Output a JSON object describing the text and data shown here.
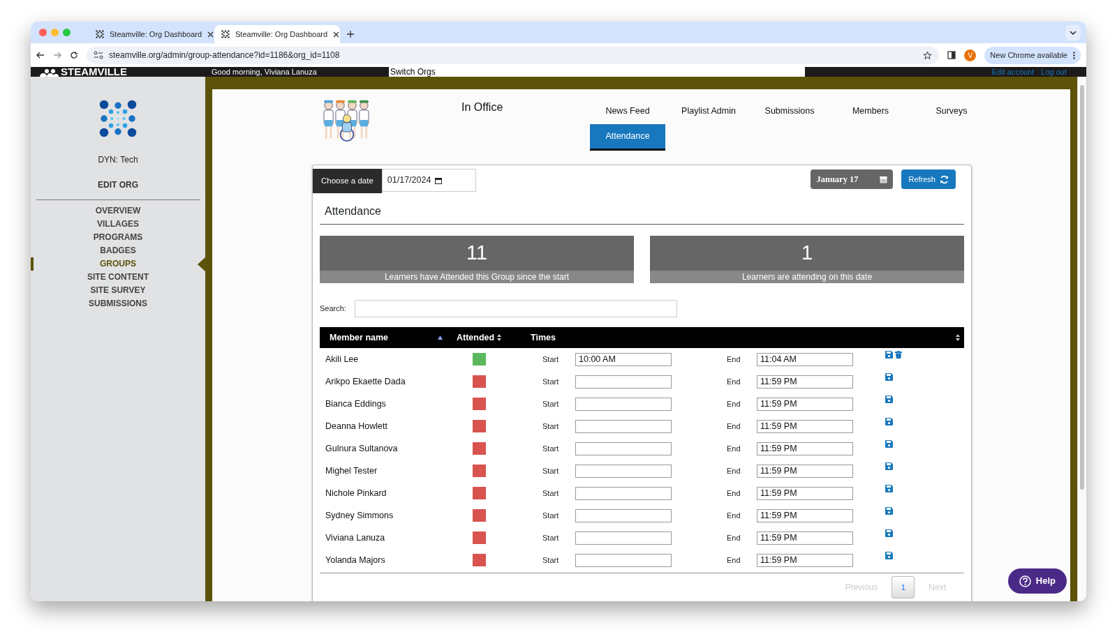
{
  "browser": {
    "tabs": [
      {
        "title": "Steamville: Org Dashboard",
        "selected": false
      },
      {
        "title": "Steamville: Org Dashboard",
        "selected": true
      }
    ],
    "url": "steamville.org/admin/group-attendance?id=1186&org_id=1108",
    "profile_initial": "V",
    "update_label": "New Chrome available"
  },
  "header": {
    "logo": "STEAMVILLE",
    "greeting": "Good morning, Viviana Lanuza",
    "switch_orgs": "Switch Orgs",
    "links": [
      "Edit account",
      "Log out"
    ]
  },
  "sidebar": {
    "org_name": "DYN: Tech",
    "edit": "EDIT ORG",
    "items": [
      {
        "label": "OVERVIEW",
        "selected": false
      },
      {
        "label": "VILLAGES",
        "selected": false
      },
      {
        "label": "PROGRAMS",
        "selected": false
      },
      {
        "label": "BADGES",
        "selected": false
      },
      {
        "label": "GROUPS",
        "selected": true
      },
      {
        "label": "SITE CONTENT",
        "selected": false
      },
      {
        "label": "SITE SURVEY",
        "selected": false
      },
      {
        "label": "SUBMISSIONS",
        "selected": false
      }
    ]
  },
  "page": {
    "title": "In Office",
    "nav": [
      {
        "label": "News Feed",
        "selected": false
      },
      {
        "label": "Playlist Admin",
        "selected": false
      },
      {
        "label": "Submissions",
        "selected": false
      },
      {
        "label": "Members",
        "selected": false
      },
      {
        "label": "Surveys",
        "selected": false
      },
      {
        "label": "Attendance",
        "selected": true
      }
    ]
  },
  "toolbar": {
    "date_label": "Choose a date",
    "date_value": "01/17/2024",
    "date_chip": "January 17",
    "refresh": "Refresh"
  },
  "section_title": "Attendance",
  "stats": [
    {
      "value": "11",
      "caption": "Learners have Attended this Group since the start"
    },
    {
      "value": "1",
      "caption": "Learners are attending on this date"
    }
  ],
  "search": {
    "label": "Search:"
  },
  "table": {
    "columns": [
      {
        "label": "Member name",
        "sorted": true
      },
      {
        "label": "Attended",
        "sorted": false
      },
      {
        "label": "Times",
        "sorted": false
      }
    ],
    "rows": [
      {
        "name": "Akili Lee",
        "attended": true,
        "start_label": "Start",
        "start": "10:00 AM",
        "end_label": "End",
        "end": "11:04 AM",
        "deletable": true
      },
      {
        "name": "Arikpo Ekaette Dada",
        "attended": false,
        "start_label": "Start",
        "end_label": "End",
        "end": "11:59 PM",
        "deletable": false
      },
      {
        "name": "Bianca Eddings",
        "attended": false,
        "start_label": "Start",
        "end_label": "End",
        "end": "11:59 PM",
        "deletable": false
      },
      {
        "name": "Deanna Howlett",
        "attended": false,
        "start_label": "Start",
        "end_label": "End",
        "end": "11:59 PM",
        "deletable": false
      },
      {
        "name": "Gulnura Sultanova",
        "attended": false,
        "start_label": "Start",
        "end_label": "End",
        "end": "11:59 PM",
        "deletable": false
      },
      {
        "name": "Mighel Tester",
        "attended": false,
        "start_label": "Start",
        "end_label": "End",
        "end": "11:59 PM",
        "deletable": false
      },
      {
        "name": "Nichole Pinkard",
        "attended": false,
        "start_label": "Start",
        "end_label": "End",
        "end": "11:59 PM",
        "deletable": false
      },
      {
        "name": "Sydney Simmons",
        "attended": false,
        "start_label": "Start",
        "end_label": "End",
        "end": "11:59 PM",
        "deletable": false
      },
      {
        "name": "Viviana Lanuza",
        "attended": false,
        "start_label": "Start",
        "end_label": "End",
        "end": "11:59 PM",
        "deletable": false
      },
      {
        "name": "Yolanda Majors",
        "attended": false,
        "start_label": "Start",
        "end_label": "End",
        "end": "11:59 PM",
        "deletable": false
      }
    ]
  },
  "pagination": {
    "previous": "Previous",
    "pages": [
      {
        "label": "1",
        "selected": true
      }
    ],
    "next": "Next"
  },
  "help": "Help"
}
